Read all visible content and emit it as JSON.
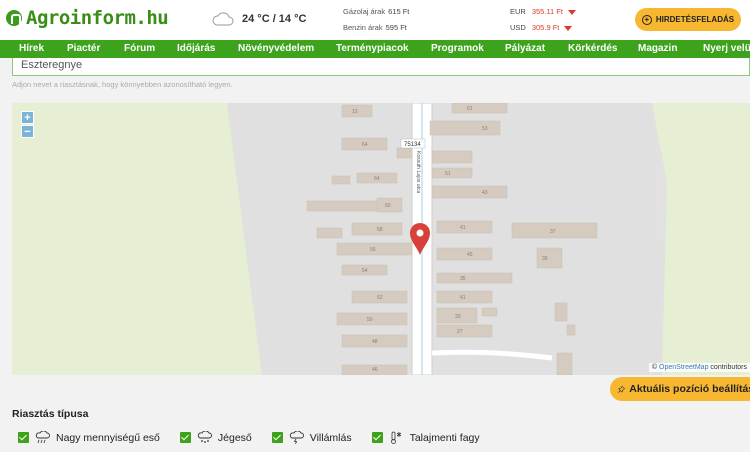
{
  "header": {
    "logo_text": "Agroinform.hu",
    "weather_temp": "24 °C / 14 °C",
    "fuel": [
      {
        "label": "Gázolaj árak",
        "value": "615 Ft"
      },
      {
        "label": "Benzin árak",
        "value": "595 Ft"
      }
    ],
    "fx": [
      {
        "label": "EUR",
        "value": "355.11 Ft"
      },
      {
        "label": "USD",
        "value": "305.9 Ft"
      }
    ],
    "ad_button": "HIRDETÉSFELADÁS"
  },
  "nav": [
    "Hírek",
    "Piactér",
    "Fórum",
    "Időjárás",
    "Növényvédelem",
    "Terménypiacok",
    "Programok",
    "Pályázat",
    "Körkérdés",
    "Magazin",
    "Nyerj velünk"
  ],
  "form": {
    "name_value": "Eszteregnye",
    "name_hint": "Adjon nevet a riasztásnak, hogy könnyebben azonosítható legyen."
  },
  "map": {
    "zoom_in": "+",
    "zoom_out": "−",
    "road_label": "75134",
    "street_label": "Kossuth Lajos utca",
    "house_numbers": [
      "12",
      "64",
      "64",
      "60",
      "58",
      "56",
      "54",
      "52",
      "50",
      "48",
      "46",
      "61",
      "53",
      "51",
      "43",
      "41",
      "45",
      "35",
      "41",
      "33",
      "27",
      "37",
      "39"
    ],
    "attribution_prefix": "©",
    "attribution_link": "OpenStreetMap",
    "attribution_suffix": "contributors"
  },
  "position_button": "Aktuális pozíció beállítása",
  "alert_type_title": "Riasztás típusa",
  "alert_types": [
    {
      "label": "Nagy mennyiségű eső",
      "icon": "heavy-rain-icon",
      "checked": true
    },
    {
      "label": "Jégeső",
      "icon": "hail-icon",
      "checked": true
    },
    {
      "label": "Villámlás",
      "icon": "lightning-icon",
      "checked": true
    },
    {
      "label": "Talajmenti fagy",
      "icon": "frost-icon",
      "checked": true
    }
  ],
  "colors": {
    "brand_green": "#3da21c",
    "accent_yellow": "#f7b731",
    "marker_red": "#d8413a"
  }
}
